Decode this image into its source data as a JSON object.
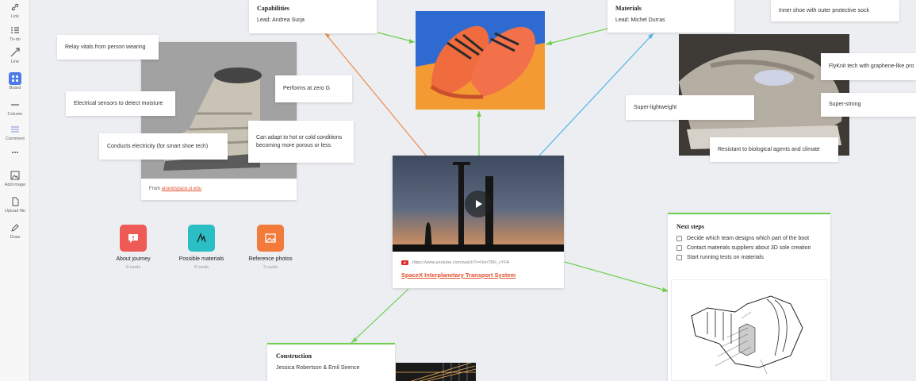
{
  "toolbar": {
    "items": [
      {
        "label": "Link",
        "icon": "link-icon"
      },
      {
        "label": "To-do",
        "icon": "todo-icon"
      },
      {
        "label": "Line",
        "icon": "line-icon"
      },
      {
        "label": "Board",
        "icon": "board-icon"
      },
      {
        "label": "Column",
        "icon": "column-icon"
      },
      {
        "label": "Comment",
        "icon": "comment-icon"
      },
      {
        "label": "",
        "icon": "more-icon"
      },
      {
        "label": "Add image",
        "icon": "image-icon"
      },
      {
        "label": "Upload file",
        "icon": "file-icon"
      },
      {
        "label": "Draw",
        "icon": "pencil-icon"
      }
    ],
    "active_color": "#4c7ce8"
  },
  "capabilities": {
    "title": "Capabilities",
    "lead": "Lead: Andrea Surja"
  },
  "materials": {
    "title": "Materials",
    "lead": "Lead: Michel Durras"
  },
  "inner_shoe_note": "Inner shoe with outer protective sock",
  "left_notes": {
    "relay": "Relay vitals from person wearing",
    "sensors": "Electrical sensors to detect moisture",
    "zero_g": "Performs at zero G",
    "conducts": "Conducts electricity (for smart shoe tech)",
    "adapt": "Can adapt to hot or cold conditions becoming more porous or less"
  },
  "boot_image": {
    "source_prefix": "From ",
    "source_link": "airandspace.si.edu"
  },
  "right_notes": {
    "flyknit": "FlyKnit tech with graphene-like pro",
    "super_light": "Super-lightweight",
    "super_strong": "Super-strong",
    "resistant": "Resistant to biological agents and climate"
  },
  "boards": [
    {
      "title": "About journey",
      "sub": "0 cards",
      "color": "#ee5a55",
      "icon": "comment-alert-icon"
    },
    {
      "title": "Possible materials",
      "sub": "8 cards",
      "color": "#2bbfc5",
      "icon": "scribble-icon"
    },
    {
      "title": "Reference photos",
      "sub": "3 cards",
      "color": "#f27b3c",
      "icon": "photos-icon"
    }
  ],
  "video": {
    "url": "https://www.youtube.com/watch?v=0on7BR_vYFA",
    "title": "SpaceX Interplanetary Transport System"
  },
  "next_steps": {
    "title": "Next steps",
    "items": [
      "Decide which team designs which part of the boot",
      "Contact materials suppliers about 3D sole creation",
      "Start running tests on materials"
    ]
  },
  "construction": {
    "title": "Construction",
    "sub": "Jessica Robertson & Emil Sirence"
  },
  "colors": {
    "orange_line": "#f08a4b",
    "green_line": "#6fcf4f",
    "blue_line": "#4fb4e8",
    "green_accent": "#6fcf4f"
  }
}
